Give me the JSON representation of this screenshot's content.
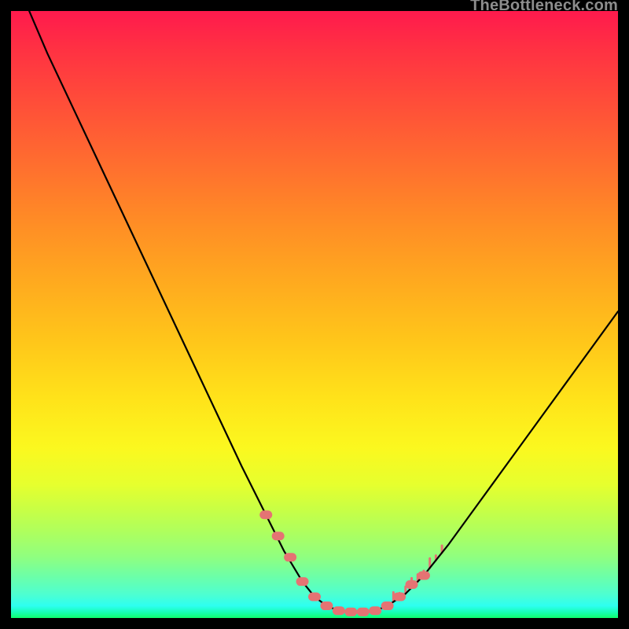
{
  "watermark": "TheBottleneck.com",
  "colors": {
    "page_bg": "#000000",
    "curve_stroke": "#000000",
    "marker_fill": "#e57373",
    "watermark_text": "#8d8d8d"
  },
  "chart_data": {
    "type": "line",
    "title": "",
    "xlabel": "",
    "ylabel": "",
    "xlim": [
      0,
      100
    ],
    "ylim": [
      0,
      100
    ],
    "grid": false,
    "legend": false,
    "series": [
      {
        "name": "bottleneck-curve",
        "x": [
          3,
          6,
          10,
          14,
          18,
          22,
          26,
          30,
          34,
          38,
          42,
          45,
          48,
          50,
          52,
          54,
          56,
          58,
          60,
          62,
          65,
          68,
          72,
          76,
          80,
          84,
          88,
          92,
          96,
          100
        ],
        "values": [
          100,
          93,
          84.5,
          76,
          67.5,
          59,
          50.5,
          42,
          33.5,
          25,
          17,
          11,
          6,
          3.5,
          2,
          1.2,
          1,
          1,
          1.2,
          2,
          4,
          7,
          12,
          17.5,
          23,
          28.5,
          34,
          39.5,
          45,
          50.5
        ]
      }
    ],
    "markers": {
      "name": "highlight-dots",
      "x": [
        42,
        44,
        46,
        48,
        50,
        52,
        54,
        56,
        58,
        60,
        62,
        64,
        66,
        68
      ],
      "values": [
        17,
        13.5,
        10,
        6,
        3.5,
        2,
        1.2,
        1,
        1,
        1.2,
        2,
        3.5,
        5.5,
        7
      ]
    },
    "ticks": {
      "name": "small-upward-ticks",
      "x": [
        63,
        64,
        65,
        66,
        67,
        68,
        69,
        70,
        71
      ]
    }
  }
}
